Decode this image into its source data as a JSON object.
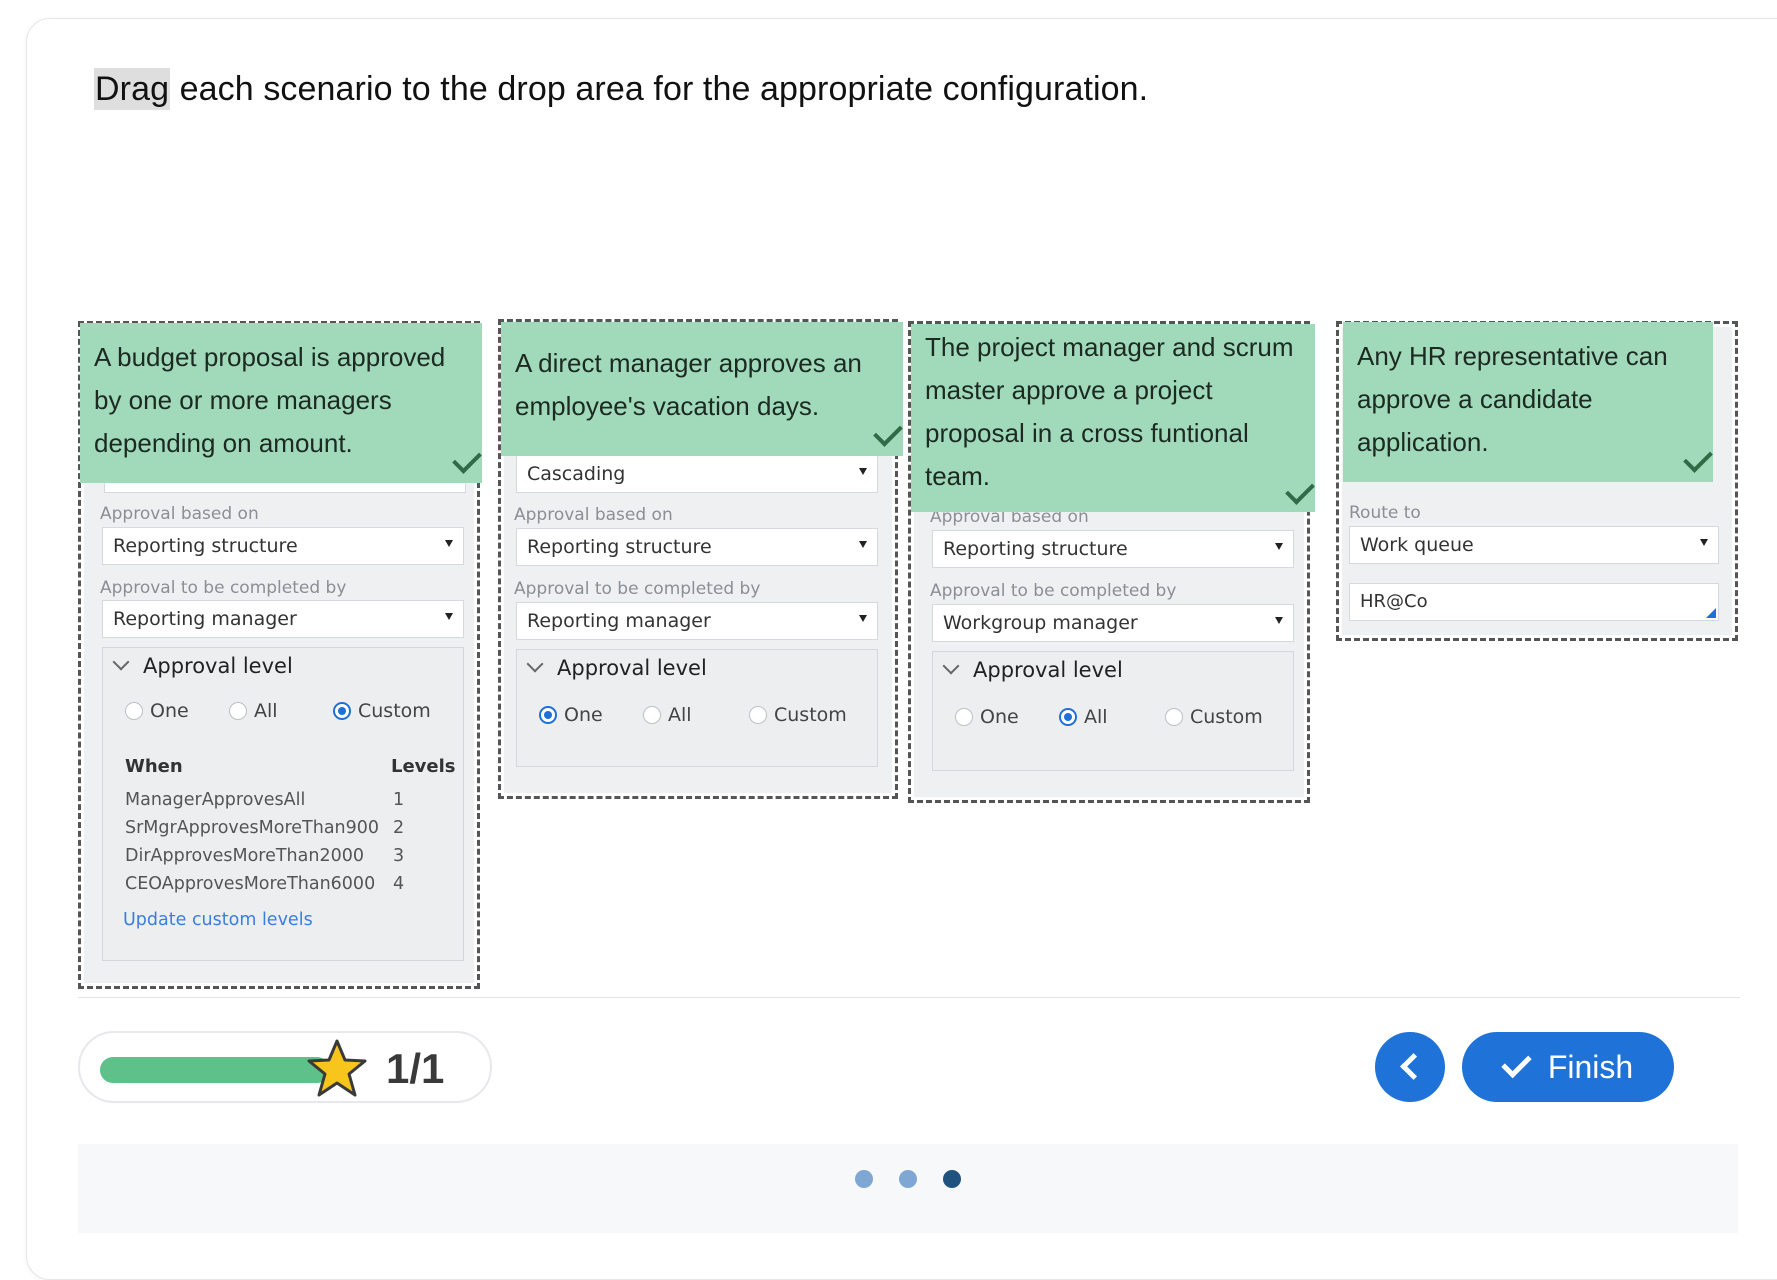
{
  "instruction": {
    "highlight": "Drag",
    "rest": " each scenario to the drop area for the appropriate configuration."
  },
  "zones": [
    {
      "scenario": "A budget proposal is approved by one or more managers depending on amount.",
      "approval_based_on_label": "Approval based on",
      "approval_based_on_value": "Reporting structure",
      "completed_by_label": "Approval to be completed by",
      "completed_by_value": "Reporting manager",
      "approval_level_label": "Approval level",
      "radios": [
        "One",
        "All",
        "Custom"
      ],
      "selected": "Custom",
      "custom_table": {
        "when_header": "When",
        "levels_header": "Levels",
        "rows": [
          {
            "when": "ManagerApprovesAll",
            "level": "1"
          },
          {
            "when": "SrMgrApprovesMoreThan900",
            "level": "2"
          },
          {
            "when": "DirApprovesMoreThan2000",
            "level": "3"
          },
          {
            "when": "CEOApprovesMoreThan6000",
            "level": "4"
          }
        ],
        "link": "Update custom levels"
      }
    },
    {
      "scenario": "A direct manager approves an employee's vacation days.",
      "top_select_value": "Cascading",
      "approval_based_on_label": "Approval based on",
      "approval_based_on_value": "Reporting structure",
      "completed_by_label": "Approval to be completed by",
      "completed_by_value": "Reporting manager",
      "approval_level_label": "Approval level",
      "radios": [
        "One",
        "All",
        "Custom"
      ],
      "selected": "One"
    },
    {
      "scenario": "The project manager and scrum master approve a project proposal in a cross funtional team.",
      "approval_based_on_label": "Approval based on",
      "approval_based_on_value": "Reporting structure",
      "completed_by_label": "Approval to be completed by",
      "completed_by_value": "Workgroup manager",
      "approval_level_label": "Approval level",
      "radios": [
        "One",
        "All",
        "Custom"
      ],
      "selected": "All"
    },
    {
      "scenario": "Any HR representative can approve a candidate application.",
      "route_to_label": "Route to",
      "route_to_value": "Work queue",
      "queue_value": "HR@Co"
    }
  ],
  "progress": {
    "count_text": "1/1",
    "fraction": 1.0
  },
  "buttons": {
    "finish": "Finish",
    "back_icon": "chevron-left-icon",
    "finish_icon": "check-icon"
  },
  "pager": {
    "total": 3,
    "active_index": 2
  },
  "colors": {
    "tile": "#a1d9bb",
    "accent": "#1f73d8",
    "progress_fill": "#5ec189",
    "star": "#f7c51b",
    "dot_inactive": "#7ea8d3",
    "dot_active": "#20527f"
  }
}
